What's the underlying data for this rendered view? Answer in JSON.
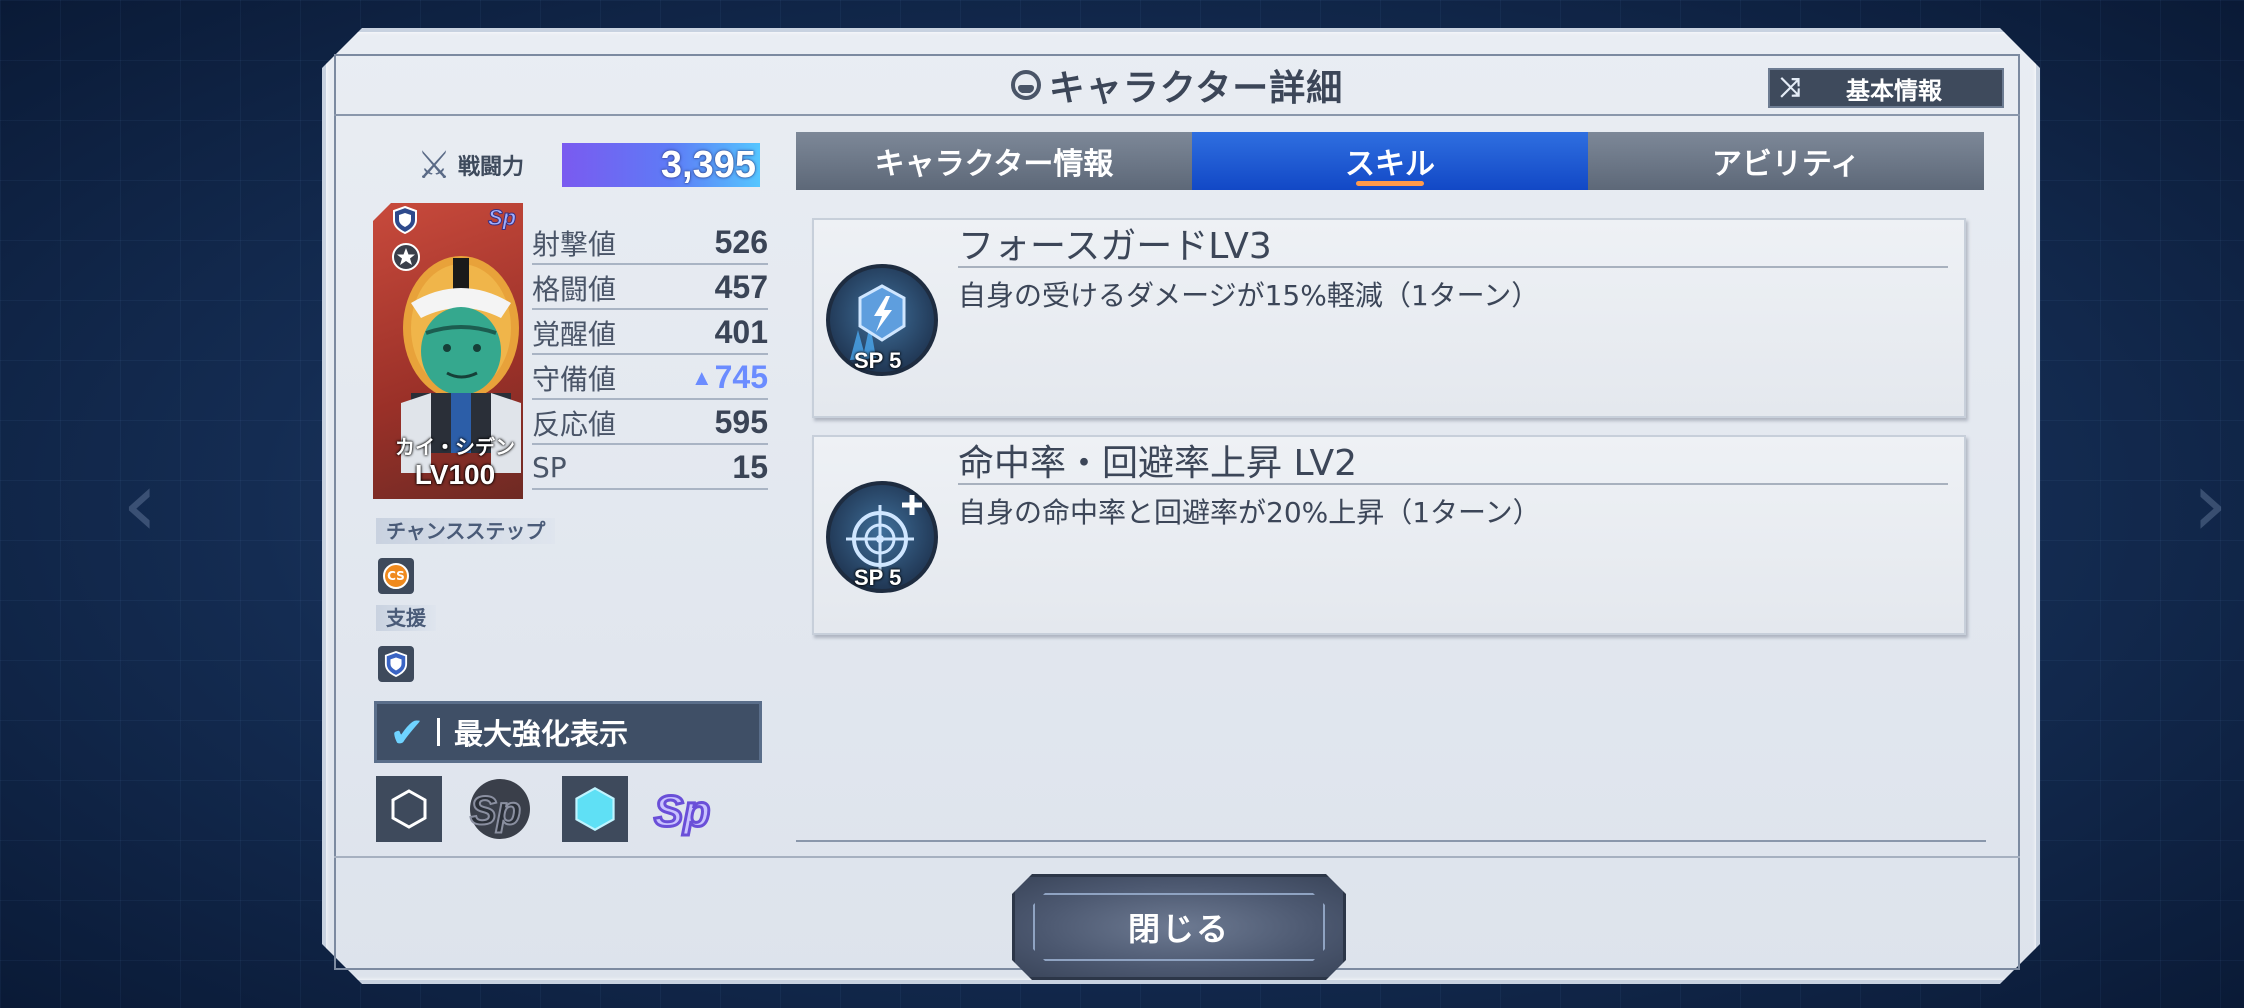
{
  "header": {
    "title": "キャラクター詳細",
    "basic_info_button": "基本情報"
  },
  "combat": {
    "label": "戦闘力",
    "value": "3,395"
  },
  "character": {
    "name": "カイ・シデン",
    "level": "LV100"
  },
  "stats": [
    {
      "label": "射撃値",
      "value": "526"
    },
    {
      "label": "格闘値",
      "value": "457"
    },
    {
      "label": "覚醒値",
      "value": "401"
    },
    {
      "label": "守備値",
      "value": "745",
      "boosted": true
    },
    {
      "label": "反応値",
      "value": "595"
    },
    {
      "label": "SP",
      "value": "15"
    }
  ],
  "chance_step": {
    "label": "チャンスステップ",
    "icon_text": "CS"
  },
  "support": {
    "label": "支援"
  },
  "max_enhance": {
    "label": "最大強化表示",
    "checked": true
  },
  "tabs": [
    {
      "label": "キャラクター情報",
      "active": false
    },
    {
      "label": "スキル",
      "active": true
    },
    {
      "label": "アビリティ",
      "active": false
    }
  ],
  "skills": [
    {
      "name": "フォースガードLV3",
      "description": "自身の受けるダメージが15%軽減（1ターン）",
      "sp": "SP 5",
      "icon": "shield-lightning-icon"
    },
    {
      "name": "命中率・回避率上昇 LV2",
      "description": "自身の命中率と回避率が20%上昇（1ターン）",
      "sp": "SP 5",
      "icon": "crosshair-plus-icon"
    }
  ],
  "close_button": "閉じる",
  "colors": {
    "active_tab": "#1b55d0",
    "panel_bg": "#e6eaf0",
    "combat_bar_start": "#7a5af0",
    "combat_bar_end": "#55c6ff",
    "boost_blue": "#6b8cff",
    "tab_underline": "#ff9a4a"
  }
}
